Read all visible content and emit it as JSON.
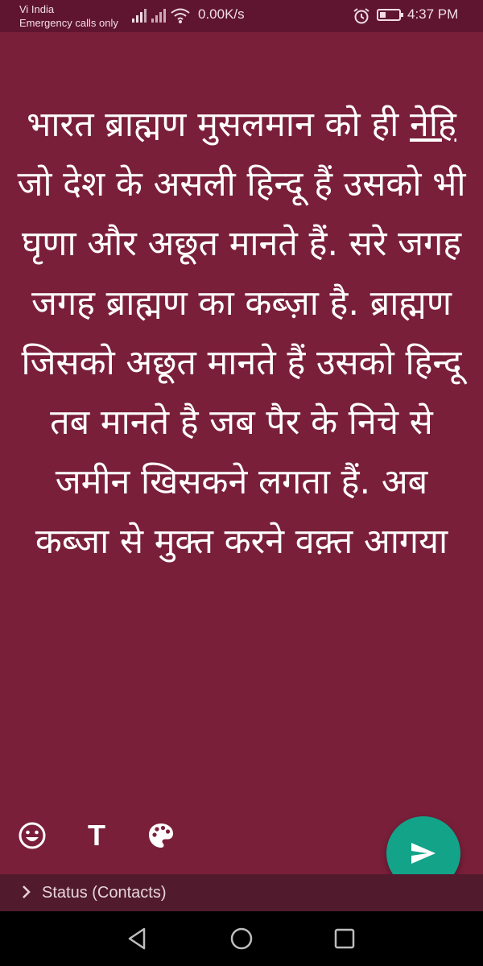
{
  "status_bar": {
    "carrier": "Vi India",
    "carrier_sub": "Emergency calls only",
    "net_speed": "0.00K/s",
    "time": "4:37 PM",
    "icons": [
      "signal-icon",
      "signal-no-service-icon",
      "wifi-icon",
      "alarm-icon",
      "battery-icon"
    ]
  },
  "status_text": {
    "before_underline": "भारत ब्राह्मण मुसलमान को ही ",
    "underlined": "नेहि",
    "after_underline": " जो देश के असली हिन्दू हैं उसको भी घृणा और अछूत मानते हैं. सरे जगह जगह ब्राह्मण का कब्ज़ा है. ब्राह्मण जिसको अछूत मानते हैं उसको हिन्दू तब मानते है जब पैर के निचे से जमीन खिसकने लगता हैं. अब कब्जा से मुक्त करने वक़्त आगया",
    "background_color": "#7a1f3a"
  },
  "tools": {
    "emoji_icon": "emoji-icon",
    "text_style_label": "T",
    "palette_icon": "palette-icon"
  },
  "send_button": {
    "icon": "send-icon",
    "color": "#12a389"
  },
  "recipient": {
    "label": "Status (Contacts)"
  },
  "nav_bar": {
    "icons": [
      "back-icon",
      "home-icon",
      "recents-icon"
    ]
  }
}
